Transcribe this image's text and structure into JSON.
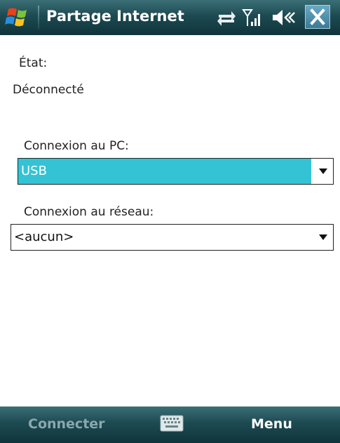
{
  "title_bar": {
    "app_title": "Partage Internet",
    "icons": [
      "windows-start-icon",
      "sync-icon",
      "signal-icon",
      "volume-icon",
      "close-icon"
    ],
    "accent_color": "#1d4a52"
  },
  "status": {
    "label": "État:",
    "value": "Déconnecté"
  },
  "pc_connection": {
    "label": "Connexion au PC:",
    "selected": "USB",
    "highlight_color": "#34c3d4"
  },
  "network_connection": {
    "label": "Connexion au réseau:",
    "selected": "<aucun>"
  },
  "softkeys": {
    "left_label": "Connecter",
    "left_enabled": false,
    "right_label": "Menu",
    "center_icon": "keyboard-icon"
  }
}
